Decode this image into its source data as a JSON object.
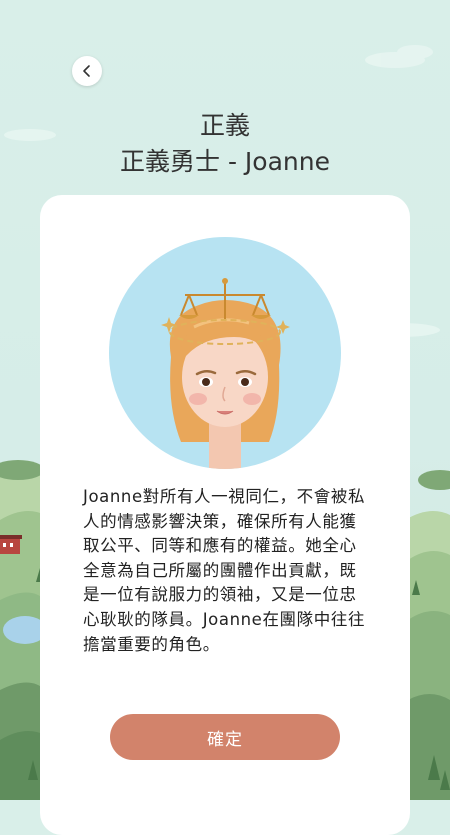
{
  "header": {
    "back_icon": "chevron-left-icon",
    "title": "正義",
    "subtitle": "正義勇士 - Joanne"
  },
  "card": {
    "avatar_description_icon": "justice-warrior-avatar-with-scales",
    "description": "Joanne對所有人一視同仁，不會被私人的情感影響決策，確保所有人能獲取公平、同等和應有的權益。她全心全意為自己所屬的團體作出貢獻，既是一位有說服力的領袖，又是一位忠心耿耿的隊員。Joanne在團隊中往往擔當重要的角色。",
    "confirm_label": "確定"
  },
  "colors": {
    "background": "#d9efe9",
    "card": "#ffffff",
    "button": "#d2836b",
    "avatar_circle": "#b7e3f2",
    "hair": "#e9a75a",
    "text": "#222222"
  }
}
